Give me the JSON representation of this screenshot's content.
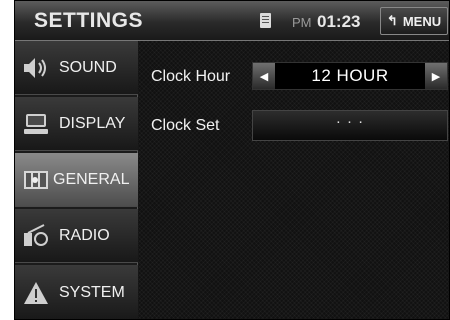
{
  "header": {
    "title": "SETTINGS",
    "ampm": "PM",
    "time": "01:23",
    "menu_label": "MENU",
    "menu_icon": "back-arrow-icon",
    "storage_icon": "sd-card-icon"
  },
  "sidebar": {
    "items": [
      {
        "label": "SOUND",
        "icon": "speaker-icon",
        "active": false
      },
      {
        "label": "DISPLAY",
        "icon": "display-icon",
        "active": false
      },
      {
        "label": "GENERAL",
        "icon": "general-tools-icon",
        "active": true
      },
      {
        "label": "RADIO",
        "icon": "radio-icon",
        "active": false
      },
      {
        "label": "SYSTEM",
        "icon": "warning-icon",
        "active": false
      }
    ]
  },
  "main": {
    "clock_hour": {
      "label": "Clock Hour",
      "value": "12 HOUR"
    },
    "clock_set": {
      "label": "Clock Set",
      "value": "· · ·"
    }
  }
}
